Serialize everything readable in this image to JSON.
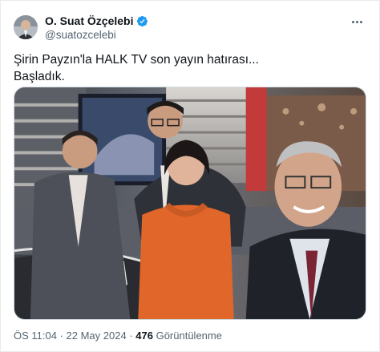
{
  "author": {
    "display_name": "O. Suat Özçelebi",
    "handle": "@suatozcelebi",
    "verified": true,
    "avatar_icon": "profile-photo"
  },
  "tweet": {
    "line1": "Şirin Payzın'la HALK TV son yayın hatırası...",
    "line2": "Başladık."
  },
  "meta": {
    "time": "ÖS 11:04",
    "separator": " · ",
    "date": "22 May 2024",
    "separator2": " · ",
    "views_count": "476",
    "views_label": " Görüntülenme"
  },
  "icons": {
    "verified": "verified-badge-icon",
    "more": "more-options-icon"
  },
  "colors": {
    "verified_blue": "#1d9bf0",
    "text_primary": "#0f1419",
    "text_secondary": "#536471"
  }
}
